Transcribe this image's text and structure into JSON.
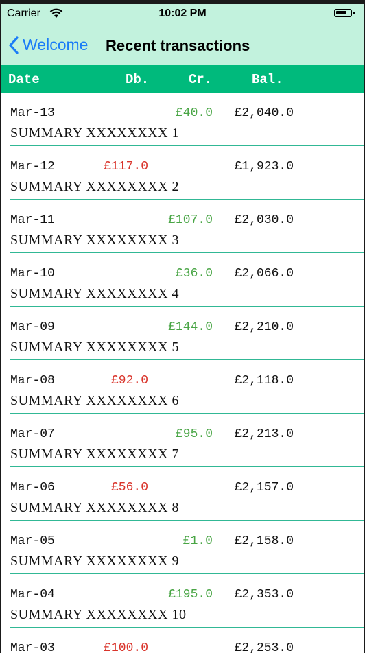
{
  "status_bar": {
    "carrier": "Carrier",
    "time": "10:02 PM",
    "wifi_icon": "wifi-icon",
    "battery_icon": "battery-icon"
  },
  "nav": {
    "back_label": "Welcome",
    "title": "Recent transactions",
    "accent_color": "#1b7cf7"
  },
  "colors": {
    "topbar_bg": "#c2f2dd",
    "header_bg": "#00ba7c",
    "debit": "#d9342b",
    "credit": "#49a545",
    "divider": "#31b895"
  },
  "table": {
    "columns": [
      "Date",
      "Db.",
      "Cr.",
      "Bal."
    ],
    "rows": [
      {
        "date": "Mar-13",
        "db": "",
        "cr": "£40.0",
        "bal": "£2,040.0",
        "summary": "SUMMARY XXXXXXXX 1"
      },
      {
        "date": "Mar-12",
        "db": "£117.0",
        "cr": "",
        "bal": "£1,923.0",
        "summary": "SUMMARY XXXXXXXX 2"
      },
      {
        "date": "Mar-11",
        "db": "",
        "cr": "£107.0",
        "bal": "£2,030.0",
        "summary": "SUMMARY XXXXXXXX 3"
      },
      {
        "date": "Mar-10",
        "db": "",
        "cr": "£36.0",
        "bal": "£2,066.0",
        "summary": "SUMMARY XXXXXXXX 4"
      },
      {
        "date": "Mar-09",
        "db": "",
        "cr": "£144.0",
        "bal": "£2,210.0",
        "summary": "SUMMARY XXXXXXXX 5"
      },
      {
        "date": "Mar-08",
        "db": "£92.0",
        "cr": "",
        "bal": "£2,118.0",
        "summary": "SUMMARY XXXXXXXX 6"
      },
      {
        "date": "Mar-07",
        "db": "",
        "cr": "£95.0",
        "bal": "£2,213.0",
        "summary": "SUMMARY XXXXXXXX 7"
      },
      {
        "date": "Mar-06",
        "db": "£56.0",
        "cr": "",
        "bal": "£2,157.0",
        "summary": "SUMMARY XXXXXXXX 8"
      },
      {
        "date": "Mar-05",
        "db": "",
        "cr": "£1.0",
        "bal": "£2,158.0",
        "summary": "SUMMARY XXXXXXXX 9"
      },
      {
        "date": "Mar-04",
        "db": "",
        "cr": "£195.0",
        "bal": "£2,353.0",
        "summary": "SUMMARY XXXXXXXX 10"
      },
      {
        "date": "Mar-03",
        "db": "£100.0",
        "cr": "",
        "bal": "£2,253.0",
        "summary": ""
      }
    ]
  }
}
